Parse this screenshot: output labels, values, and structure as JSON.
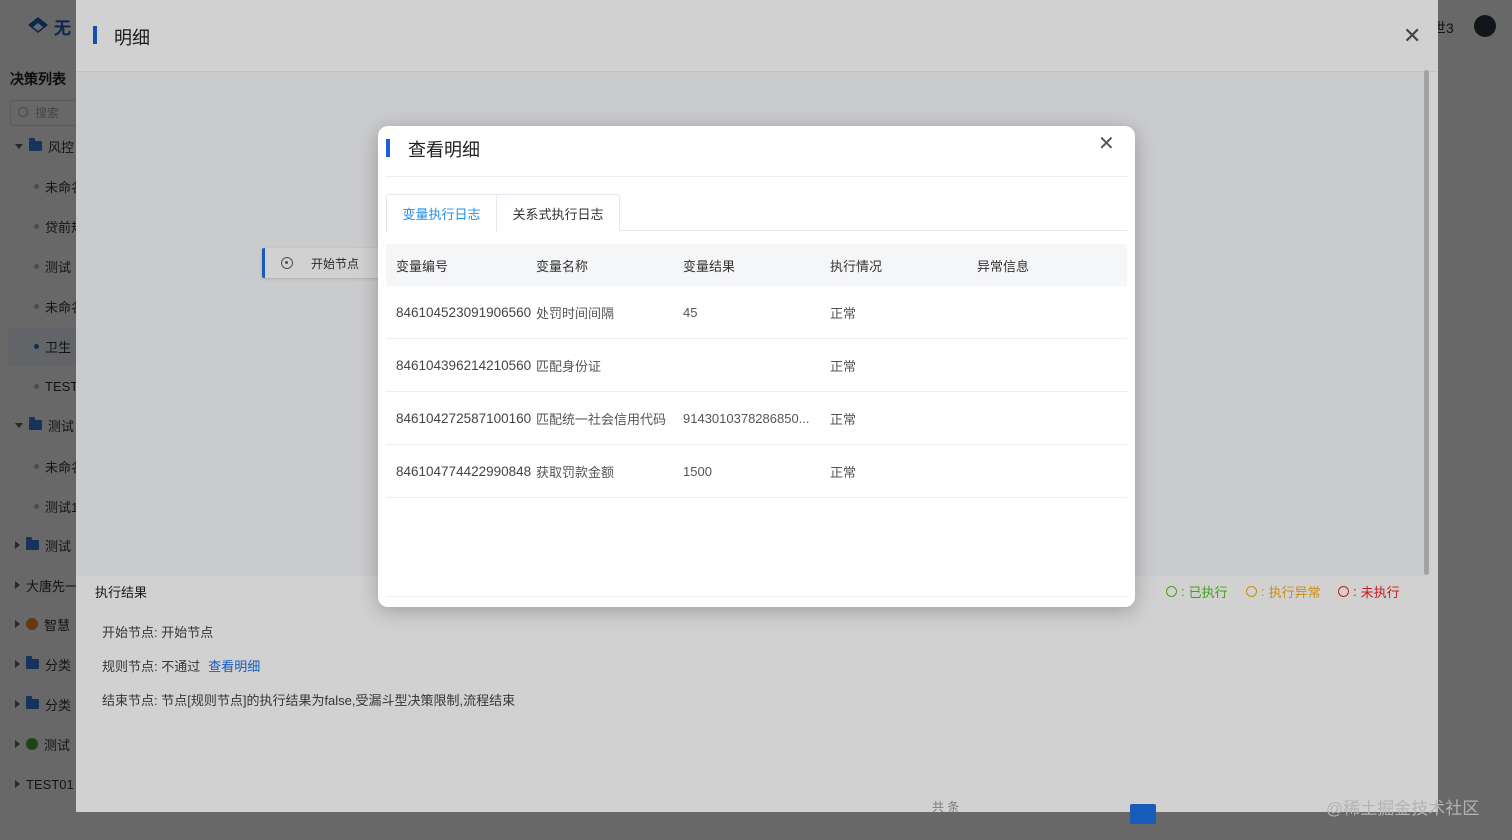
{
  "app": {
    "logo_text": "无",
    "user_name": "世3"
  },
  "sidebar": {
    "title": "决策列表",
    "search_placeholder": "搜索",
    "items": [
      {
        "label": "风控",
        "kind": "folder",
        "expanded": true
      },
      {
        "label": "未命名",
        "kind": "leaf"
      },
      {
        "label": "贷前规",
        "kind": "leaf"
      },
      {
        "label": "测试",
        "kind": "leaf"
      },
      {
        "label": "未命名",
        "kind": "leaf"
      },
      {
        "label": "卫生",
        "kind": "leaf",
        "active": true
      },
      {
        "label": "TEST",
        "kind": "leaf"
      },
      {
        "label": "测试",
        "kind": "folder",
        "expanded": true
      },
      {
        "label": "未命名",
        "kind": "leaf"
      },
      {
        "label": "测试1",
        "kind": "leaf"
      },
      {
        "label": "测试",
        "kind": "folder",
        "expanded": false
      },
      {
        "label": "大唐先一",
        "kind": "group"
      },
      {
        "label": "智慧",
        "kind": "badge-orange"
      },
      {
        "label": "分类",
        "kind": "folder",
        "expanded": false
      },
      {
        "label": "分类",
        "kind": "folder",
        "expanded": false
      },
      {
        "label": "测试",
        "kind": "badge-green"
      },
      {
        "label": "TEST01",
        "kind": "group"
      }
    ]
  },
  "drawer": {
    "title": "明细",
    "canvas": {
      "start_node_label": "开始节点"
    },
    "result": {
      "heading": "执行结果",
      "legend": [
        {
          "label": "已执行",
          "color": "#52c41a"
        },
        {
          "label": "执行异常",
          "color": "#faad14"
        },
        {
          "label": "未执行",
          "color": "#f5222d"
        }
      ],
      "lines": [
        {
          "text": "开始节点: 开始节点"
        },
        {
          "text": "规则节点: 不通过",
          "link": "查看明细"
        },
        {
          "text": "结束节点: 节点[规则节点]的执行结果为false,受漏斗型决策限制,流程结束"
        }
      ]
    },
    "pager_text": "共 条"
  },
  "modal": {
    "title": "查看明细",
    "tabs": [
      {
        "label": "变量执行日志",
        "active": true
      },
      {
        "label": "关系式执行日志",
        "active": false
      }
    ],
    "table": {
      "columns": [
        "变量编号",
        "变量名称",
        "变量结果",
        "执行情况",
        "异常信息"
      ],
      "rows": [
        {
          "id": "846104523091906560",
          "name": "处罚时间间隔",
          "result": "45",
          "status": "正常",
          "error": ""
        },
        {
          "id": "846104396214210560",
          "name": "匹配身份证",
          "result": "",
          "status": "正常",
          "error": ""
        },
        {
          "id": "846104272587100160",
          "name": "匹配统一社会信用代码",
          "result": "9143010378286850...",
          "status": "正常",
          "error": ""
        },
        {
          "id": "846104774422990848",
          "name": "获取罚款金额",
          "result": "1500",
          "status": "正常",
          "error": ""
        }
      ]
    }
  },
  "watermark": "@稀土掘金技术社区",
  "colors": {
    "accent": "#1f5fd6",
    "tab_active": "#1f8ff0",
    "link": "#1f6fe5"
  }
}
